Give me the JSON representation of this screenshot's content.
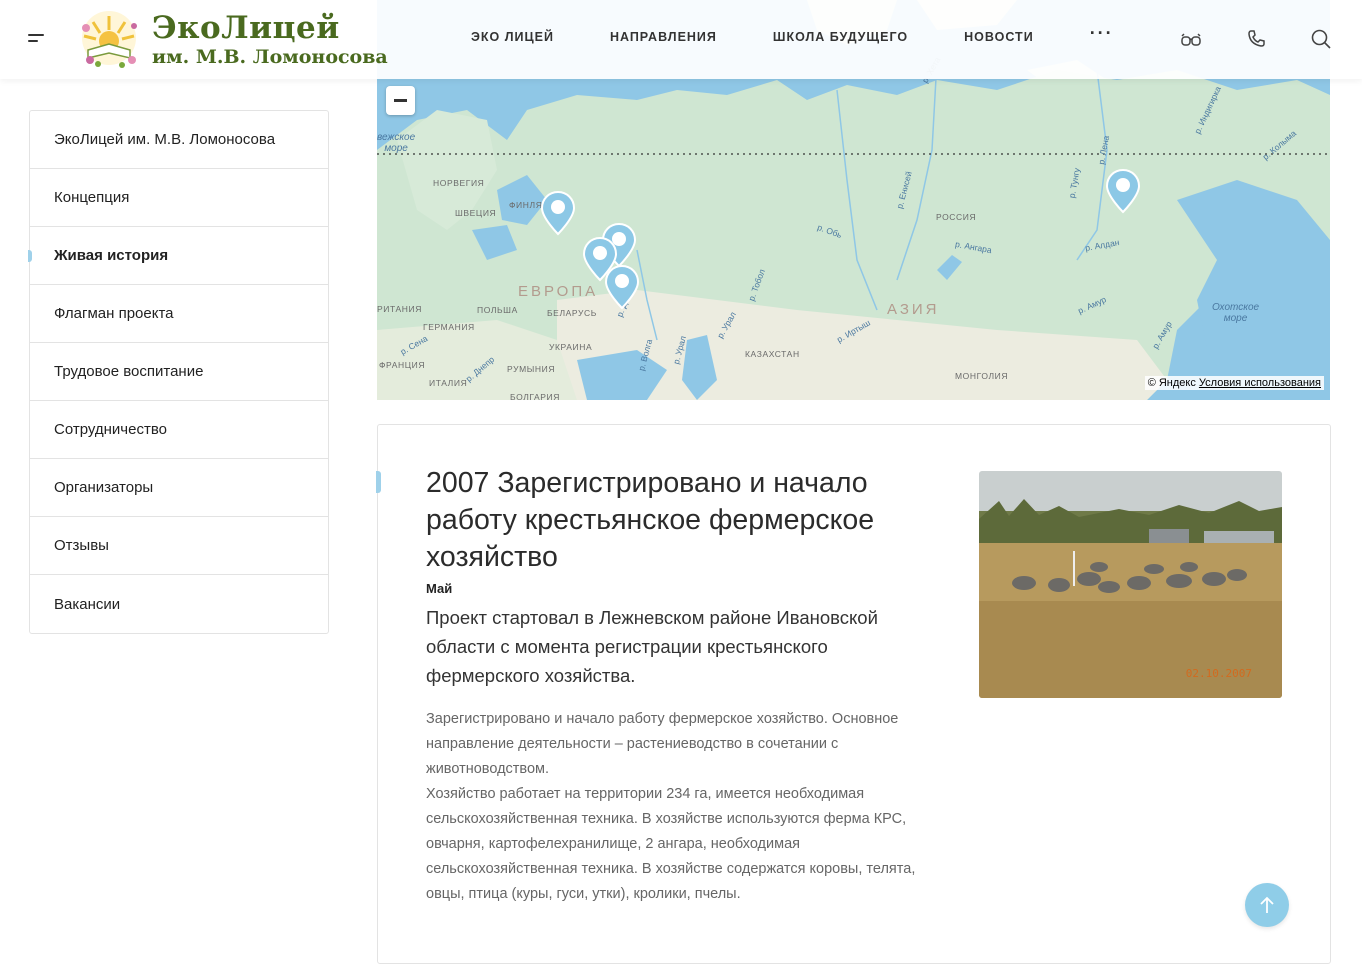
{
  "header": {
    "logo_line1": "ЭкоЛицей",
    "logo_line2": "им. М.В. Ломоносова",
    "nav": [
      "ЭКО ЛИЦЕЙ",
      "НАПРАВЛЕНИЯ",
      "ШКОЛА БУДУЩЕГО",
      "НОВОСТИ",
      "···"
    ],
    "icons": [
      "menu-icon",
      "eye-glasses-icon",
      "phone-icon",
      "search-icon"
    ],
    "accent_color": "#4a6a1f"
  },
  "sidebar": {
    "items": [
      {
        "label": "ЭкоЛицей им. М.В. Ломоносова",
        "active": false
      },
      {
        "label": "Концепция",
        "active": false
      },
      {
        "label": "Живая история",
        "active": true
      },
      {
        "label": "Флагман проекта",
        "active": false
      },
      {
        "label": "Трудовое воспитание",
        "active": false
      },
      {
        "label": "Сотрудничество",
        "active": false
      },
      {
        "label": "Организаторы",
        "active": false
      },
      {
        "label": "Отзывы",
        "active": false
      },
      {
        "label": "Вакансии",
        "active": false
      }
    ],
    "active_marker_color": "#9fd1ea"
  },
  "map": {
    "regions": {
      "europe": "ЕВРОПА",
      "asia": "АЗИЯ"
    },
    "countries": {
      "norway": "НОРВЕГИЯ",
      "sweden": "ШВЕЦИЯ",
      "finland": "ФИНЛЯ",
      "russia": "РОССИЯ",
      "britain": "РИТАНИЯ",
      "germany": "ГЕРМАНИЯ",
      "poland": "ПОЛЬША",
      "belarus": "БЕЛАРУСЬ",
      "ukraine": "УКРАИНА",
      "france": "ФРАНЦИЯ",
      "italy": "ИТАЛИЯ",
      "romania": "РУМЫНИЯ",
      "bulgaria": "БОЛГАРИЯ",
      "kazakhstan": "КАЗАХСТАН",
      "mongolia": "МОНГОЛИЯ"
    },
    "seas": {
      "norwegian": "вежское\nморе",
      "okhotsk": "Охотское\nморе"
    },
    "rivers": {
      "don": "р. Дон",
      "volga": "р. Волга",
      "ural_1": "р. Урал",
      "ural_2": "р. Урал",
      "tobol": "р. Тобол",
      "irtysh": "р. Иртыш",
      "ob": "р. Обь",
      "yenisei": "р. Енисей",
      "angara": "р. Ангара",
      "tunguska": "р. Тунгу",
      "aldan": "р. Алдан",
      "lena": "р. Лена",
      "amur_1": "р. Амур",
      "amur_2": "р. Амур",
      "indigirka": "р. Индигирка",
      "kolyma": "р. Колыма",
      "seine": "р. Сена",
      "dnepr": "р. Днепр",
      "khatanga": "р. Хета"
    },
    "copyright": "© Яндекс",
    "terms_link": "Условия использования",
    "pin_color": "#8cc8e6",
    "pins": 5
  },
  "event": {
    "title": "2007 Зарегистрировано и начало работу крестьянское фермерское хозяйство",
    "month": "Май",
    "lead": "Проект стартовал в Лежневском районе Ивановской области с момента регистрации крестьянского фермерского хозяйства.",
    "body_p1": "Зарегистрировано и начало работу фермерское хозяйство. Основное направление деятельности – растениеводство в сочетании с животноводством.",
    "body_p2": "Хозяйство работает на территории 234 га, имеется необходимая сельскохозяйственная техника. В хозяйстве используются ферма КРС, овчарня, картофелехранилище, 2 ангара, необходимая сельскохозяйственная техника. В хозяйстве содержатся коровы, телята, овцы, птица (куры, гуси, утки), кролики, пчелы.",
    "photo_date": "02.10.2007"
  },
  "scroll_top_icon": "arrow-up-icon"
}
